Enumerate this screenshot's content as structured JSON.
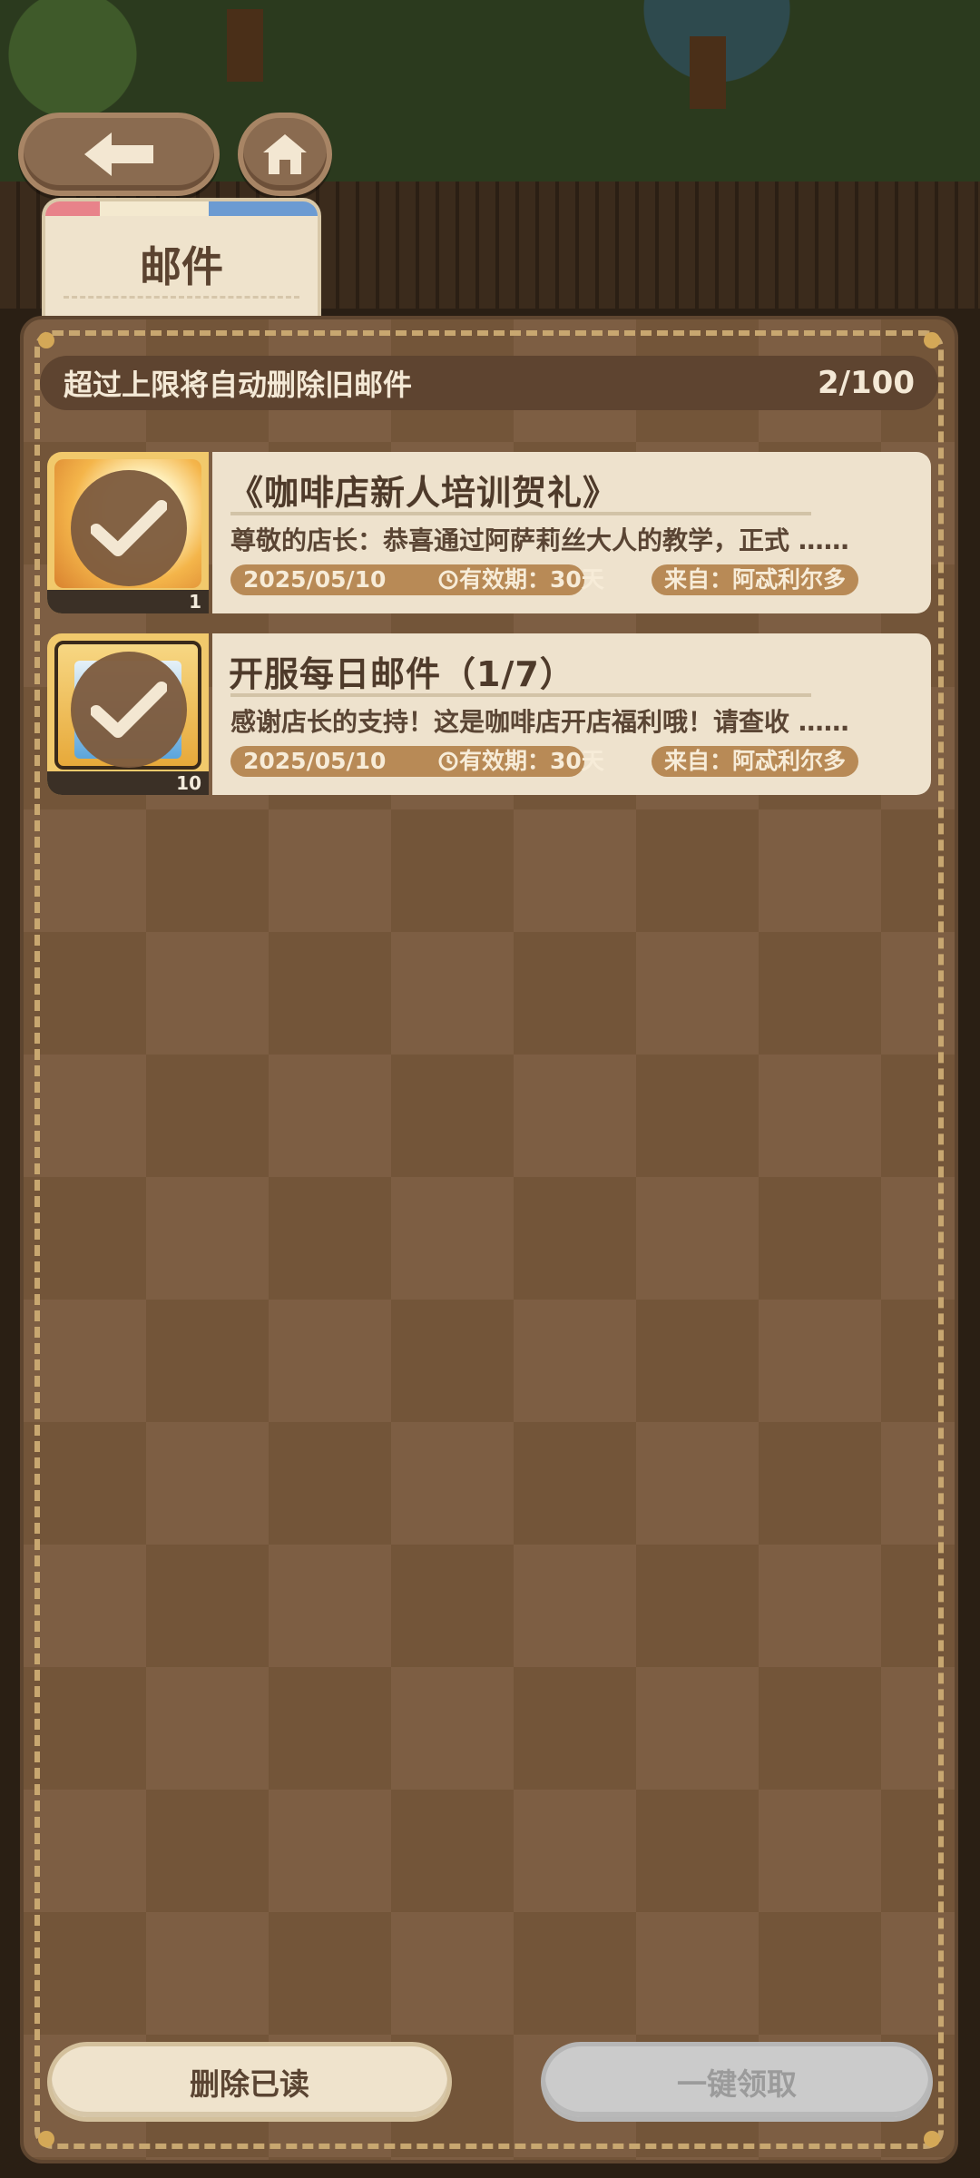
{
  "tab": {
    "label": "邮件"
  },
  "notice": {
    "text": "超过上限将自动删除旧邮件",
    "count": "2/100"
  },
  "mails": [
    {
      "title": "《咖啡店新人培训贺礼》",
      "desc": "尊敬的店长：恭喜通过阿萨莉丝大人的教学，正式 ……",
      "date": "2025/05/10",
      "validity": "有效期：30天",
      "from": "来自：阿忒利尔多",
      "item_count": "1",
      "claimed": true
    },
    {
      "title": "开服每日邮件（1/7）",
      "desc": "感谢店长的支持！这是咖啡店开店福利哦！请查收 ……",
      "date": "2025/05/10",
      "validity": "有效期：30天",
      "from": "来自：阿忒利尔多",
      "item_count": "10",
      "claimed": true
    }
  ],
  "buttons": {
    "delete_read": "删除已读",
    "claim_all": "一键领取"
  },
  "icons": {
    "back": "back-arrow-icon",
    "home": "home-icon",
    "check": "check-icon",
    "clock": "clock-icon"
  },
  "colors": {
    "panel": "#7d5e43",
    "card": "#eee2cd",
    "pill": "#b88a56",
    "disabled": "#cbcbcb"
  }
}
